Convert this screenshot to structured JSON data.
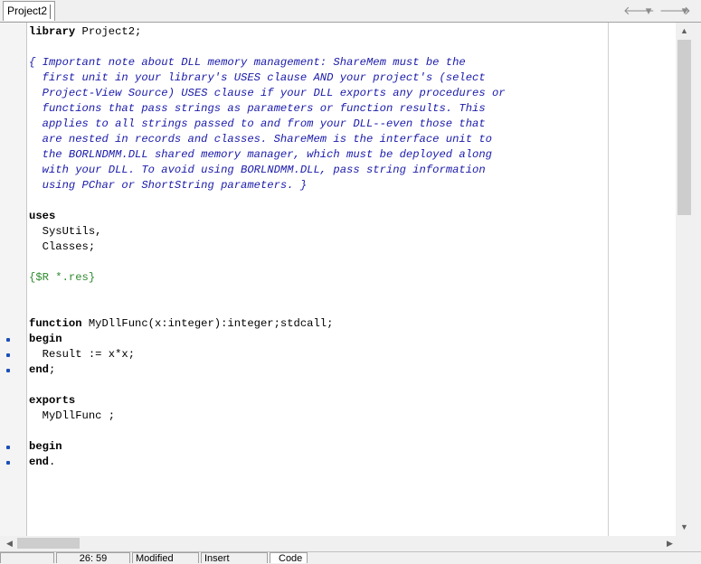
{
  "tab": {
    "label": "Project2"
  },
  "navigation": {
    "back": "🡐",
    "dropdown": "▾",
    "forward": "🡒",
    "menu": "▾"
  },
  "code": {
    "lines": [
      [
        {
          "t": "library",
          "c": "kw"
        },
        {
          "t": " Project2;",
          "c": "id"
        }
      ],
      [],
      [
        {
          "t": "{ Important note about DLL memory management: ShareMem must be the",
          "c": "cm"
        }
      ],
      [
        {
          "t": "  first unit in your library's USES clause AND your project's (select",
          "c": "cm"
        }
      ],
      [
        {
          "t": "  Project-View Source) USES clause if your DLL exports any procedures or",
          "c": "cm"
        }
      ],
      [
        {
          "t": "  functions that pass strings as parameters or function results. This",
          "c": "cm"
        }
      ],
      [
        {
          "t": "  applies to all strings passed to and from your DLL--even those that",
          "c": "cm"
        }
      ],
      [
        {
          "t": "  are nested in records and classes. ShareMem is the interface unit to",
          "c": "cm"
        }
      ],
      [
        {
          "t": "  the BORLNDMM.DLL shared memory manager, which must be deployed along",
          "c": "cm"
        }
      ],
      [
        {
          "t": "  with your DLL. To avoid using BORLNDMM.DLL, pass string information",
          "c": "cm"
        }
      ],
      [
        {
          "t": "  using PChar or ShortString parameters. }",
          "c": "cm"
        }
      ],
      [],
      [
        {
          "t": "uses",
          "c": "kw"
        }
      ],
      [
        {
          "t": "  SysUtils,",
          "c": "id"
        }
      ],
      [
        {
          "t": "  Classes;",
          "c": "id"
        }
      ],
      [],
      [
        {
          "t": "{$R *.res}",
          "c": "dir"
        }
      ],
      [],
      [],
      [
        {
          "t": "function",
          "c": "kw"
        },
        {
          "t": " MyDllFunc(x:integer):integer;stdcall;",
          "c": "id"
        }
      ],
      [
        {
          "t": "begin",
          "c": "kw"
        }
      ],
      [
        {
          "t": "  Result := x*x;",
          "c": "id"
        }
      ],
      [
        {
          "t": "end",
          "c": "kw"
        },
        {
          "t": ";",
          "c": "id"
        }
      ],
      [],
      [
        {
          "t": "exports",
          "c": "kw"
        }
      ],
      [
        {
          "t": "  MyDllFunc ;",
          "c": "id"
        }
      ],
      [],
      [
        {
          "t": "begin",
          "c": "kw"
        }
      ],
      [
        {
          "t": "end",
          "c": "kw"
        },
        {
          "t": ".",
          "c": "id"
        }
      ]
    ],
    "breakpoint_lines": [
      20,
      21,
      22,
      27,
      28
    ]
  },
  "scrollbar": {
    "up": "▲",
    "down": "▼",
    "left": "◀",
    "right": "▶"
  },
  "status": {
    "position": "26: 59",
    "modified": "Modified",
    "mode": "Insert",
    "tab": "Code"
  },
  "colors": {
    "keyword": "#000000",
    "comment": "#1a1aaa",
    "directive": "#2e8b2e",
    "breakpoint": "#1c4fb8"
  }
}
